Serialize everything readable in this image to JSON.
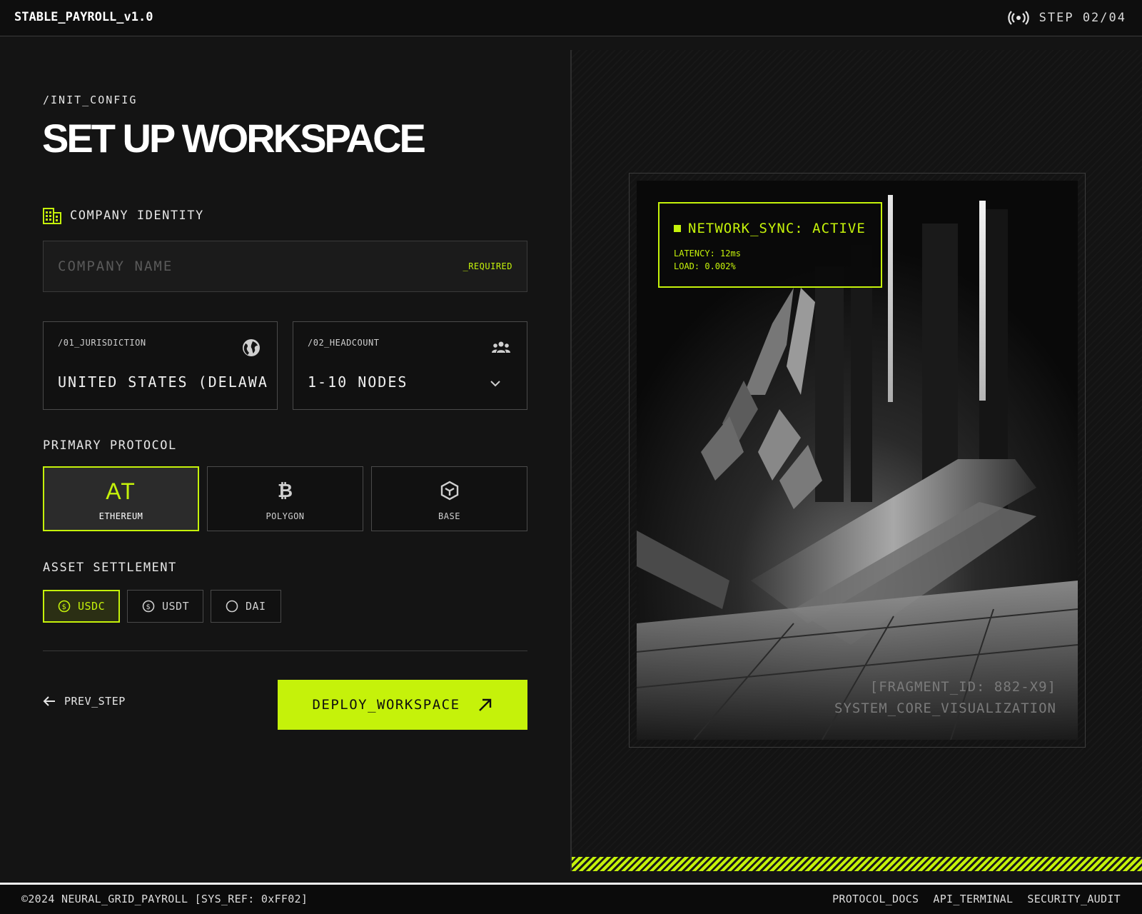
{
  "header": {
    "brand": "STABLE_PAYROLL_v1.0",
    "step": "STEP 02/04",
    "signal_icon": "signal-broadcast-icon"
  },
  "form": {
    "breadcrumb": "/INIT_CONFIG",
    "title": "SET UP WORKSPACE",
    "company_section": {
      "icon": "building-icon",
      "label": "COMPANY IDENTITY"
    },
    "company_name": {
      "placeholder": "COMPANY NAME",
      "value": "",
      "required_tag": "_REQUIRED"
    },
    "jurisdiction": {
      "label": "/01_JURISDICTION",
      "value": "UNITED STATES (DELAWARE",
      "icon": "globe-icon"
    },
    "headcount": {
      "label": "/02_HEADCOUNT",
      "value": "1-10 NODES",
      "icon": "people-group-icon"
    },
    "protocol": {
      "label": "PRIMARY PROTOCOL",
      "options": [
        {
          "name": "ETHEREUM",
          "glyph": "AT",
          "icon": "ethereum-logo-icon",
          "selected": true
        },
        {
          "name": "POLYGON",
          "glyph": "₿",
          "icon": "bitcoin-icon",
          "selected": false
        },
        {
          "name": "BASE",
          "glyph": "",
          "icon": "cube-icon",
          "selected": false
        }
      ]
    },
    "settlement": {
      "label": "ASSET SETTLEMENT",
      "options": [
        {
          "name": "USDC",
          "icon": "dollar-coin-icon",
          "selected": true
        },
        {
          "name": "USDT",
          "icon": "dollar-coin-icon",
          "selected": false
        },
        {
          "name": "DAI",
          "icon": "circle-icon",
          "selected": false
        }
      ]
    },
    "prev_label": "PREV_STEP",
    "deploy_label": "DEPLOY_WORKSPACE"
  },
  "preview": {
    "status_title": "NETWORK_SYNC: ACTIVE",
    "latency": "LATENCY: 12ms",
    "load": "LOAD: 0.002%",
    "fragment_id": "[FRAGMENT_ID: 882-X9]",
    "caption": "SYSTEM_CORE_VISUALIZATION"
  },
  "footer": {
    "copyright": "©2024 NEURAL_GRID_PAYROLL [SYS_REF: 0xFF02]",
    "links": [
      "PROTOCOL_DOCS",
      "API_TERMINAL",
      "SECURITY_AUDIT"
    ]
  },
  "colors": {
    "accent": "#c5f20a",
    "background": "#141414",
    "surface": "#111111"
  }
}
